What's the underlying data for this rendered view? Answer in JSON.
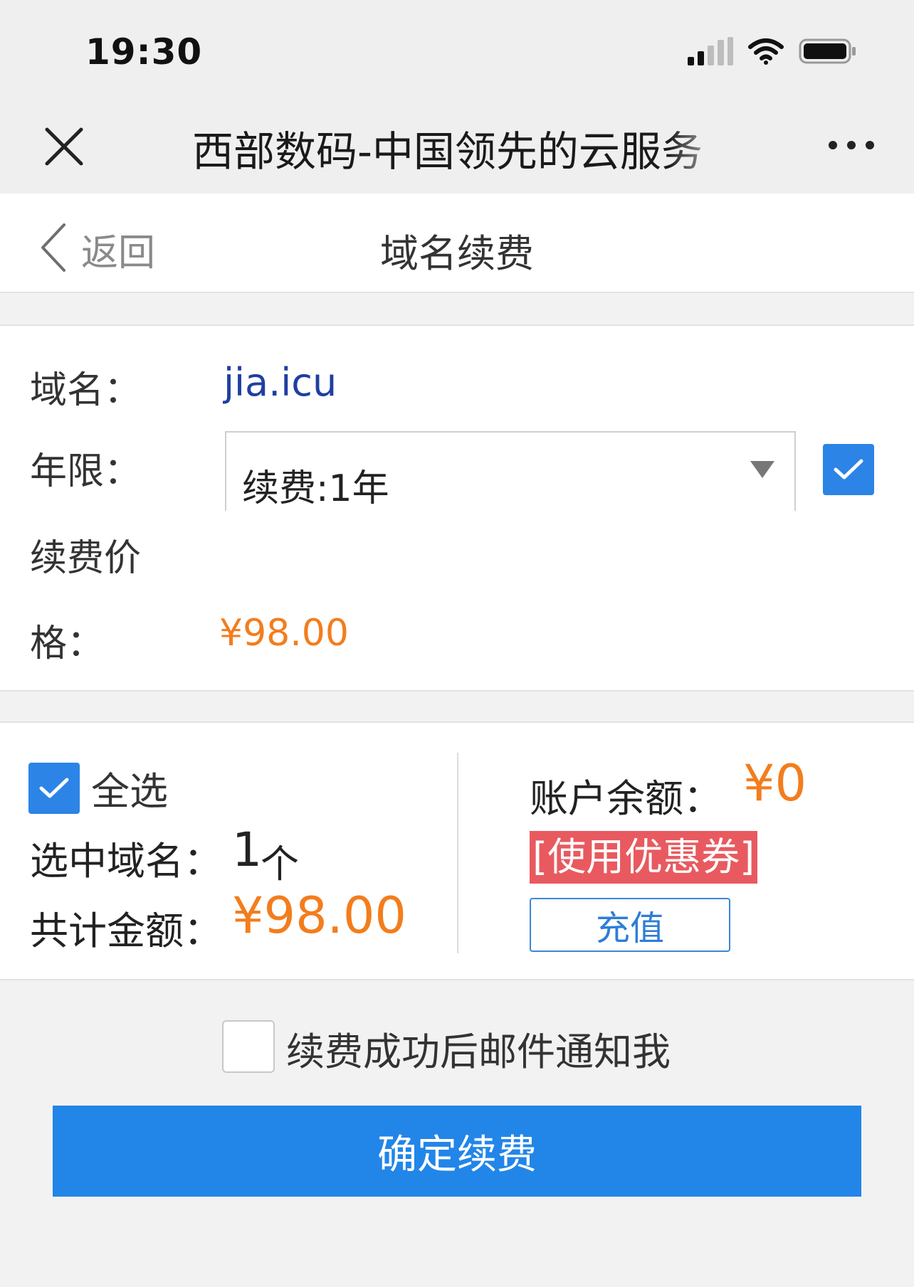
{
  "status_bar": {
    "time": "19:30"
  },
  "nav": {
    "title": "西部数码-中国领先的云服务"
  },
  "header": {
    "back_label": "返回",
    "title": "域名续费"
  },
  "domain": {
    "domain_label": "域名：",
    "domain_value": "jia.icu",
    "years_label": "年限：",
    "years_selected": "续费:1年",
    "years_checked": true,
    "price_label_line1": "续费价",
    "price_label_line2": "格：",
    "price_value": "¥98.00"
  },
  "summary": {
    "select_all_label": "全选",
    "select_all_checked": true,
    "selected_label": "选中域名：",
    "selected_count": "1",
    "selected_unit": "个",
    "total_label": "共计金额：",
    "total_value": "¥98.00",
    "balance_label": "账户余额：",
    "balance_value": "¥0",
    "coupon_label": "[使用优惠券]",
    "recharge_label": "充值"
  },
  "email_notify": {
    "label": "续费成功后邮件通知我",
    "checked": false
  },
  "confirm": {
    "label": "确定续费"
  },
  "colors": {
    "accent_blue": "#2285e8",
    "price_orange": "#f37d1d",
    "coupon_red": "#e85a5f",
    "link_blue": "#1f3fa0"
  }
}
